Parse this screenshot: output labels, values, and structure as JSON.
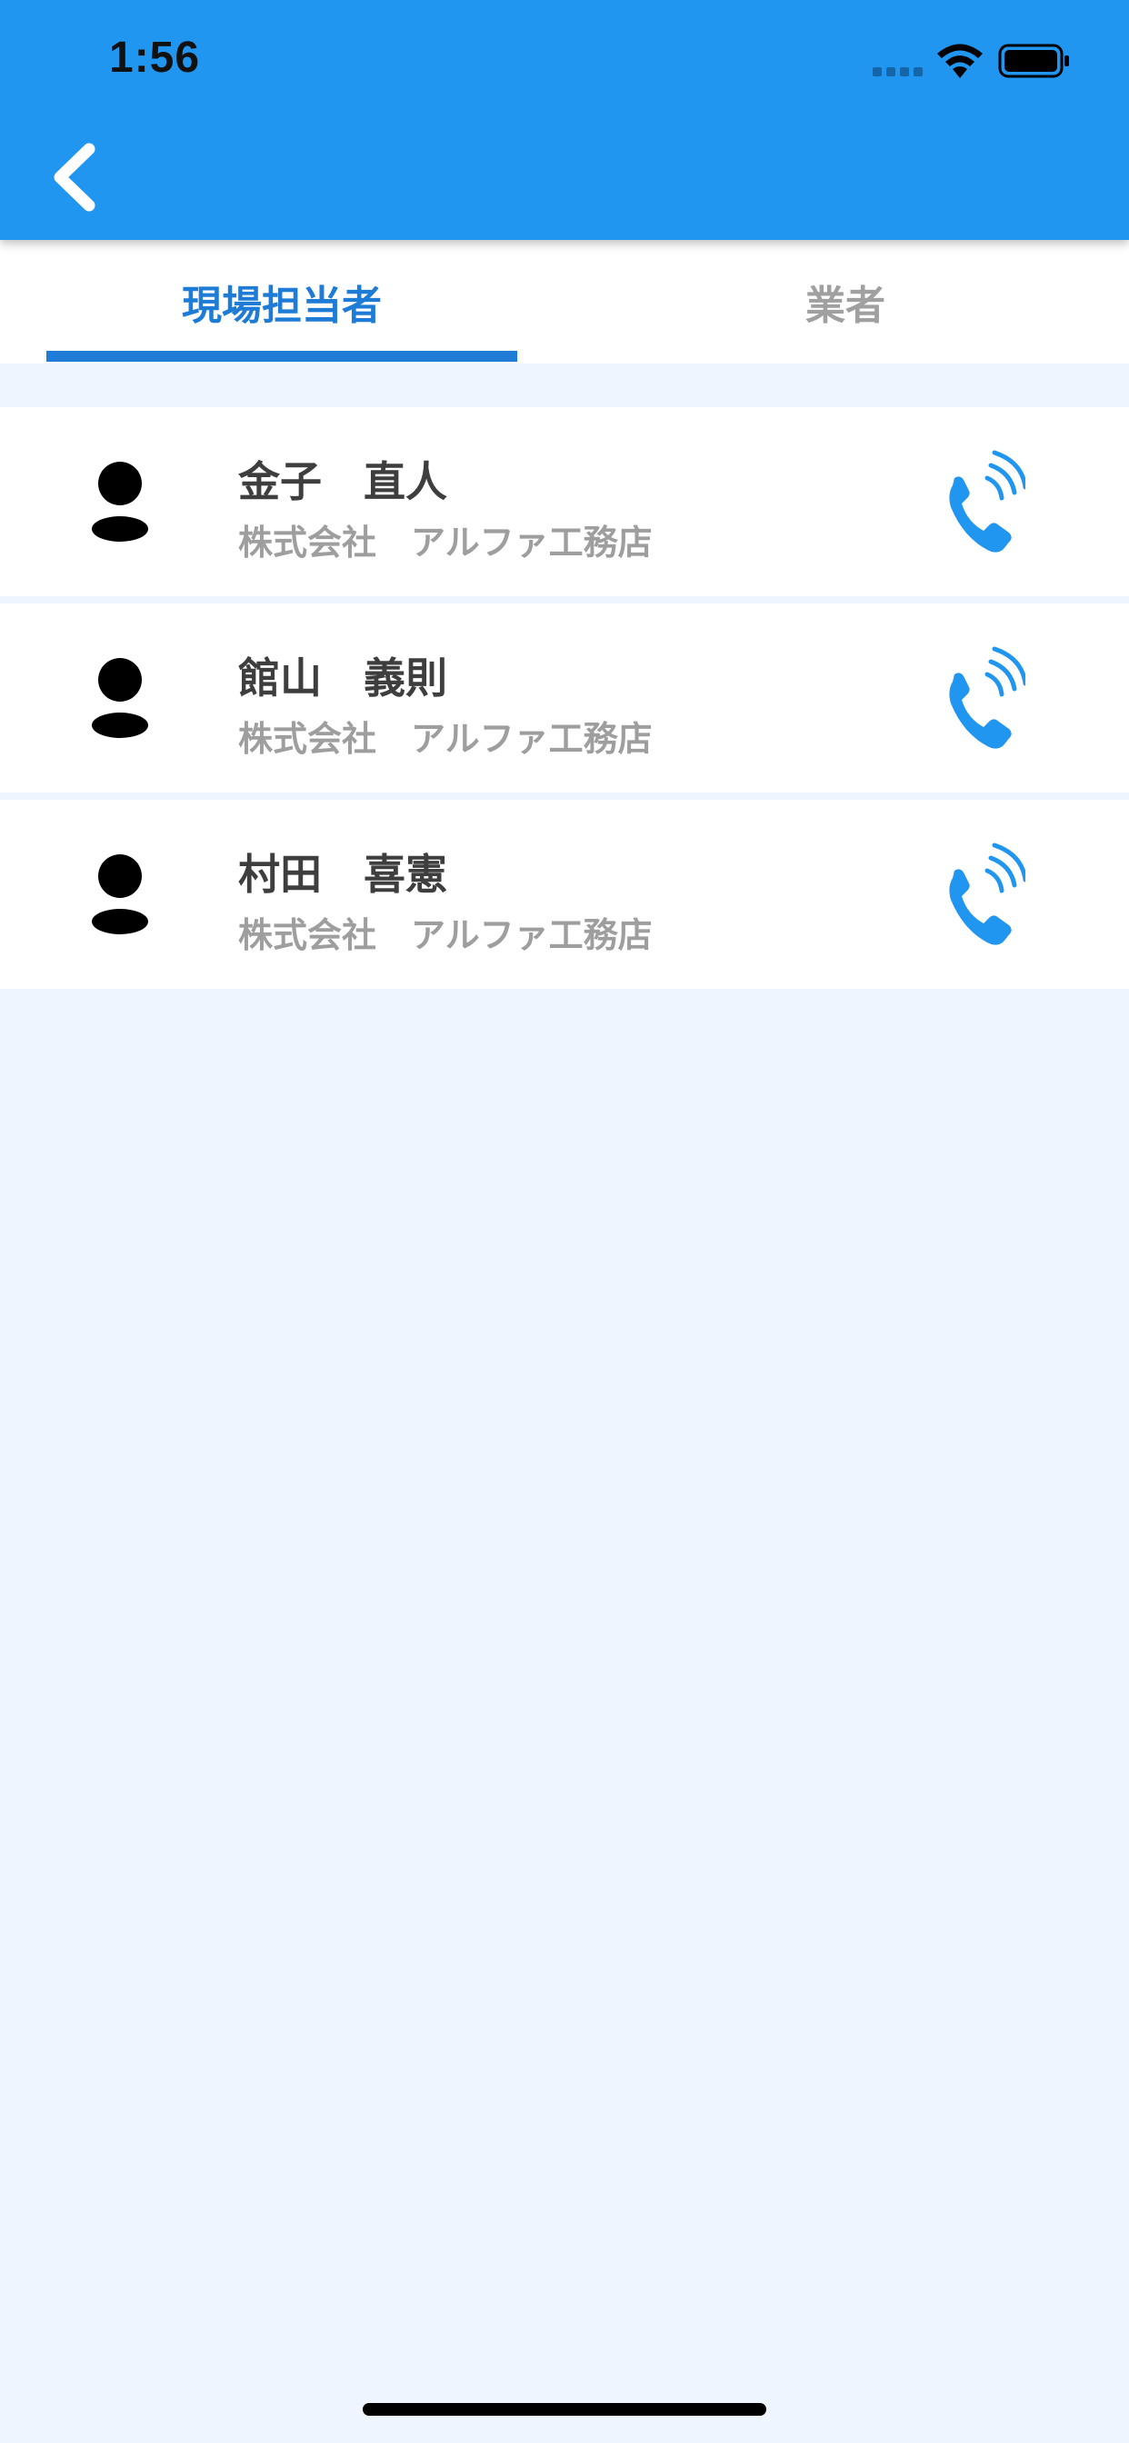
{
  "status_bar": {
    "time": "1:56"
  },
  "nav": {
    "back_icon": "chevron-left-icon"
  },
  "tabs": [
    {
      "label": "現場担当者",
      "active": true
    },
    {
      "label": "業者",
      "active": false
    }
  ],
  "contacts": [
    {
      "name": "金子　直人",
      "company": "株式会社　アルファ工務店"
    },
    {
      "name": "館山　義則",
      "company": "株式会社　アルファ工務店"
    },
    {
      "name": "村田　喜憲",
      "company": "株式会社　アルファ工務店"
    }
  ],
  "colors": {
    "header": "#2196F0",
    "accent": "#1E7BD6",
    "background": "#EEF5FE",
    "phone_icon": "#2196F0"
  }
}
